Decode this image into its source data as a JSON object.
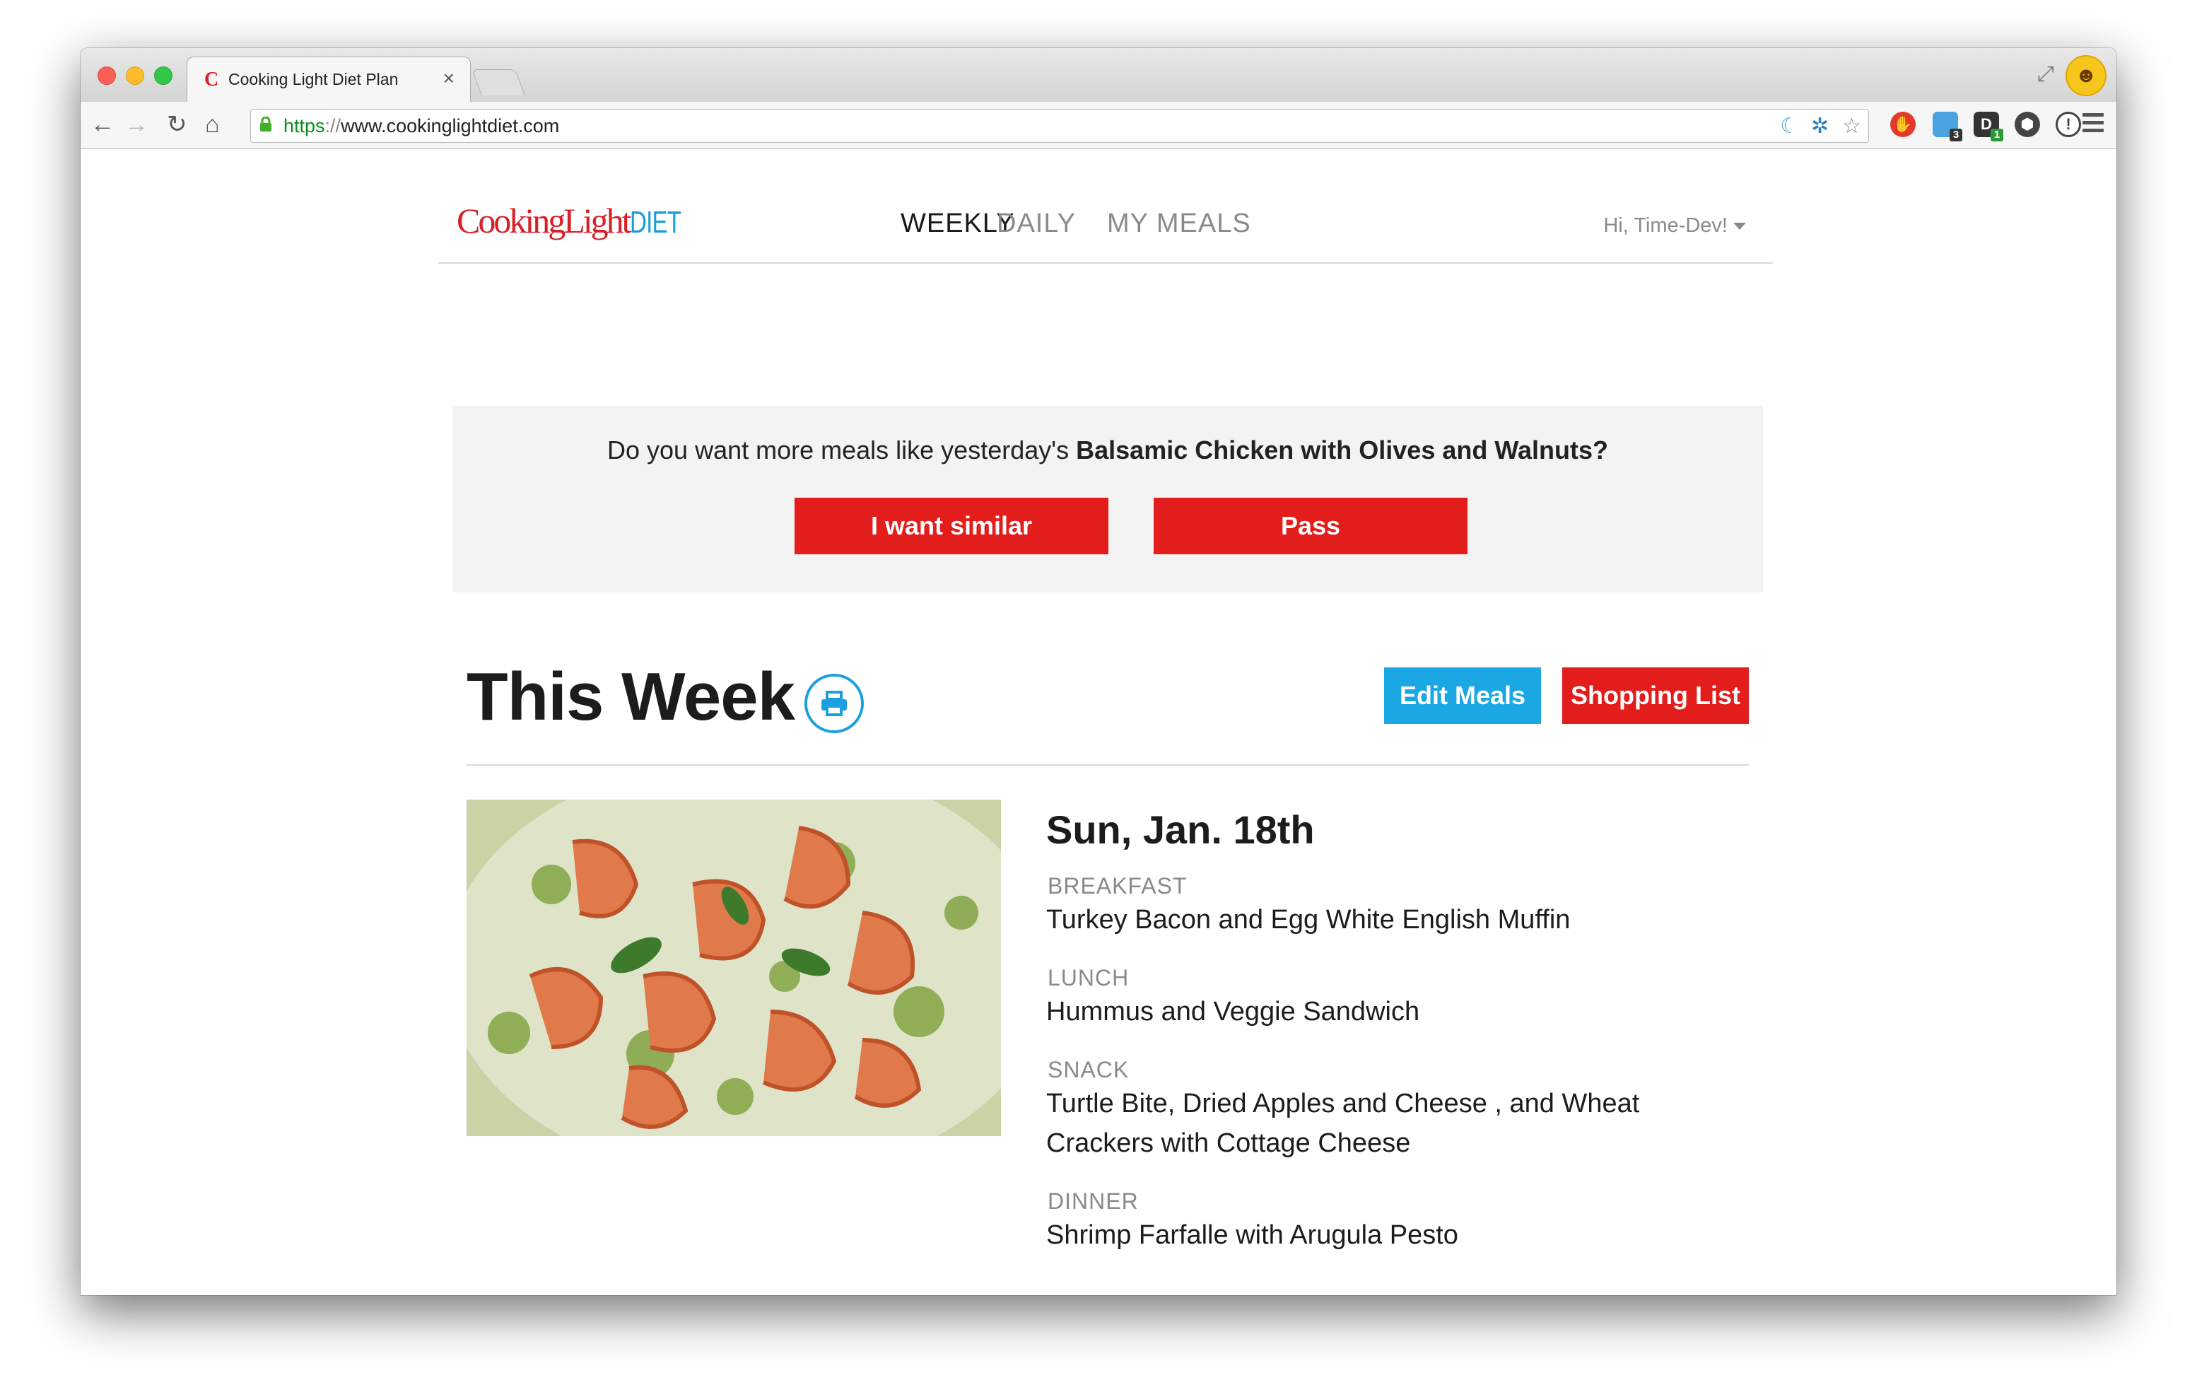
{
  "browser": {
    "tab_title": "Cooking Light Diet Plan",
    "tab_close": "×",
    "url_scheme": "https",
    "url_sep": "://",
    "url_host": "www.cookinglightdiet.com",
    "ext_badge_1": "3",
    "ext_badge_2": "1"
  },
  "site": {
    "logo_main": "CookingLight",
    "logo_suffix": "DIET",
    "nav": [
      {
        "label": "WEEKLY"
      },
      {
        "label": "DAILY"
      },
      {
        "label": "MY MEALS"
      }
    ],
    "user_greeting": "Hi, Time-Dev!"
  },
  "prompt": {
    "text_prefix": "Do you want more meals like yesterday's ",
    "meal_name": "Balsamic Chicken with Olives and Walnuts?",
    "similar_button": "I want similar",
    "pass_button": "Pass"
  },
  "week": {
    "title": "This Week",
    "edit_button": "Edit Meals",
    "shopping_button": "Shopping List"
  },
  "day": {
    "title": "Sun, Jan. 18th",
    "meals": [
      {
        "label": "BREAKFAST",
        "name": "Turkey Bacon and Egg White English Muffin"
      },
      {
        "label": "LUNCH",
        "name": "Hummus and Veggie Sandwich"
      },
      {
        "label": "SNACK",
        "name": "Turtle Bite, Dried Apples and Cheese , and Wheat Crackers with Cottage Cheese"
      },
      {
        "label": "DINNER",
        "name": "Shrimp Farfalle with Arugula Pesto"
      }
    ]
  },
  "colors": {
    "brand_red": "#e31c1c",
    "brand_blue": "#1aa7e4"
  }
}
